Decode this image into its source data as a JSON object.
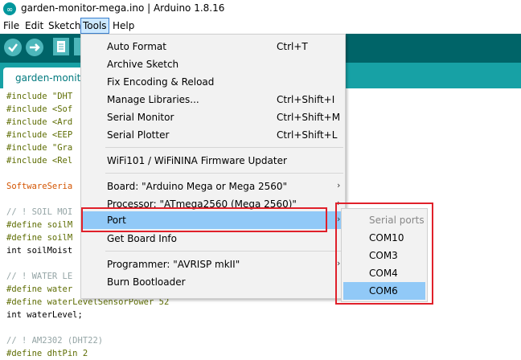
{
  "window": {
    "title": "garden-monitor-mega.ino | Arduino 1.8.16"
  },
  "menubar": {
    "file": "File",
    "edit": "Edit",
    "sketch": "Sketch",
    "tools": "Tools",
    "help": "Help"
  },
  "editor_tab": {
    "label": "garden-monito"
  },
  "code": [
    "#include \"DHT",
    "#include <Sof",
    "#include <Ard",
    "#include <EEP",
    "#include \"Gra",
    "#include <Rel",
    "SoftwareSeria",
    "// ! SOIL MOI",
    "#define soilM",
    "#define soilM",
    "int soilMoist",
    "// ! WATER LE",
    "#define water",
    "#define waterLevelSensorPower 52",
    "int waterLevel;",
    "// ! AM2302 (DHT22)",
    "#define dhtPin 2"
  ],
  "tools_menu": {
    "auto_format": {
      "label": "Auto Format",
      "shortcut": "Ctrl+T"
    },
    "archive_sketch": {
      "label": "Archive Sketch"
    },
    "fix_encoding": {
      "label": "Fix Encoding & Reload"
    },
    "manage_libraries": {
      "label": "Manage Libraries...",
      "shortcut": "Ctrl+Shift+I"
    },
    "serial_monitor": {
      "label": "Serial Monitor",
      "shortcut": "Ctrl+Shift+M"
    },
    "serial_plotter": {
      "label": "Serial Plotter",
      "shortcut": "Ctrl+Shift+L"
    },
    "wifi_updater": {
      "label": "WiFi101 / WiFiNINA Firmware Updater"
    },
    "board": {
      "label": "Board: \"Arduino Mega or Mega 2560\""
    },
    "processor": {
      "label": "Processor: \"ATmega2560 (Mega 2560)\""
    },
    "port": {
      "label": "Port"
    },
    "board_info": {
      "label": "Get Board Info"
    },
    "programmer": {
      "label": "Programmer: \"AVRISP mkII\""
    },
    "burn_bootloader": {
      "label": "Burn Bootloader"
    }
  },
  "port_submenu": {
    "header": "Serial ports",
    "ports": [
      "COM10",
      "COM3",
      "COM4",
      "COM6"
    ],
    "selected": "COM6"
  },
  "colors": {
    "toolbar": "#006468",
    "tabstrip": "#17a1a5",
    "highlight": "#91c9f7",
    "annotation": "#e0202a"
  }
}
